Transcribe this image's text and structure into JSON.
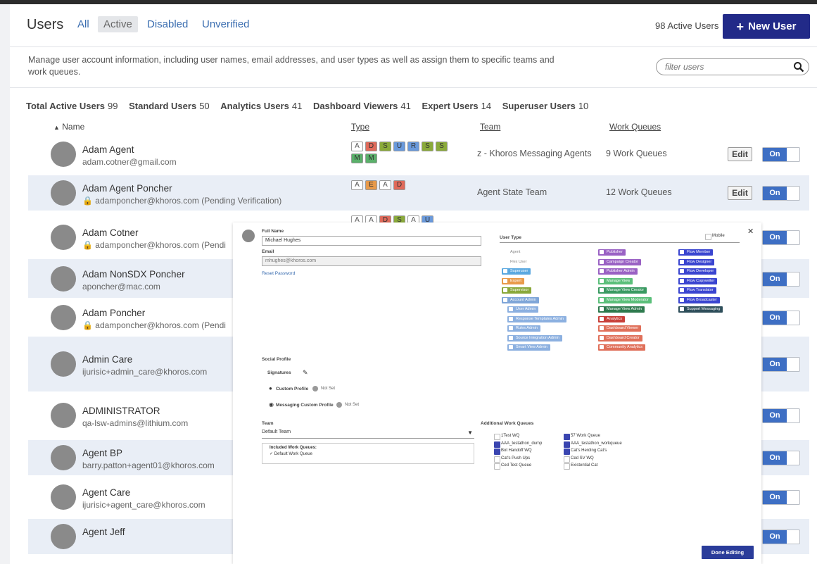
{
  "header": {
    "title": "Users",
    "tabs": [
      "All",
      "Active",
      "Disabled",
      "Unverified"
    ],
    "active_count": "98 Active Users",
    "new_user_label": "New User"
  },
  "description": "Manage user account information, including user names, email addresses, and user types as well as assign them to specific teams and work queues.",
  "filter": {
    "placeholder": "filter users"
  },
  "stats": [
    {
      "label": "Total Active Users",
      "value": "99"
    },
    {
      "label": "Standard Users",
      "value": "50"
    },
    {
      "label": "Analytics Users",
      "value": "41"
    },
    {
      "label": "Dashboard Viewers",
      "value": "41"
    },
    {
      "label": "Expert Users",
      "value": "14"
    },
    {
      "label": "Superuser Users",
      "value": "10"
    }
  ],
  "columns": {
    "name": "Name",
    "type": "Type",
    "team": "Team",
    "work_queues": "Work Queues"
  },
  "actions": {
    "edit": "Edit",
    "on": "On"
  },
  "colors": {
    "accent": "#222a88",
    "toggle": "#3e6fc4"
  },
  "users": [
    {
      "name": "Adam Agent",
      "email": "adam.cotner@gmail.com",
      "pending": "",
      "team": "z - Khoros Messaging Agents",
      "wq": "9 Work Queues",
      "badges": [
        "A",
        "D",
        "S",
        "U",
        "R",
        "S",
        "S",
        "M",
        "M"
      ]
    },
    {
      "name": "Adam Agent Poncher",
      "email": "adamponcher@khoros.com",
      "pending": "(Pending Verification)",
      "team": "Agent State Team",
      "wq": "12 Work Queues",
      "badges": [
        "A",
        "E",
        "A",
        "D"
      ]
    },
    {
      "name": "Adam Cotner",
      "email": "adamponcher@khoros.com",
      "pending": "(Pendi",
      "team": "",
      "wq": "",
      "badges": [
        "A",
        "A",
        "D",
        "S",
        "A",
        "U"
      ]
    },
    {
      "name": "Adam NonSDX Poncher",
      "email": "aponcher@mac.com",
      "pending": "",
      "team": "",
      "wq": "",
      "badges": []
    },
    {
      "name": "Adam Poncher",
      "email": "adamponcher@khoros.com",
      "pending": "(Pendi",
      "team": "",
      "wq": "",
      "badges": []
    },
    {
      "name": "Admin Care",
      "email": "ijurisic+admin_care@khoros.com",
      "pending": "",
      "team": "",
      "wq": "",
      "badges": []
    },
    {
      "name": "ADMINISTRATOR",
      "email": "qa-lsw-admins@lithium.com",
      "pending": "",
      "team": "",
      "wq": "",
      "badges": []
    },
    {
      "name": "Agent BP",
      "email": "barry.patton+agent01@khoros.com",
      "pending": "",
      "team": "",
      "wq": "",
      "badges": []
    },
    {
      "name": "Agent Care",
      "email": "ijurisic+agent_care@khoros.com",
      "pending": "",
      "team": "",
      "wq": "",
      "badges": []
    },
    {
      "name": "Agent Jeff",
      "email": "",
      "pending": "",
      "team": "",
      "wq": "",
      "badges": []
    }
  ],
  "modal": {
    "full_name_label": "Full Name",
    "full_name": "Michael Hughes",
    "email_label": "Email",
    "email": "mhughes@khoros.com",
    "reset_password": "Reset Password",
    "user_type_label": "User Type",
    "mobile": "Mobile",
    "col1": [
      {
        "t": "Agent",
        "c": "#ffffff"
      },
      {
        "t": "Flex User",
        "c": "#ffffff"
      },
      {
        "t": "Superuser",
        "c": "#5aa8e0"
      },
      {
        "t": "Expert",
        "c": "#e89a4a"
      },
      {
        "t": "Supervisor",
        "c": "#8aa83a"
      },
      {
        "t": "Account Admin",
        "c": "#7fa6d8"
      },
      {
        "t": "User Admin",
        "c": "#8cb0e0"
      },
      {
        "t": "Response Templates Admin",
        "c": "#8cb0e0"
      },
      {
        "t": "Rules Admin",
        "c": "#8cb0e0"
      },
      {
        "t": "Source Integration Admin",
        "c": "#8cb0e0"
      },
      {
        "t": "Smart View Admin",
        "c": "#8cb0e0"
      }
    ],
    "col2": [
      {
        "t": "Publisher",
        "c": "#9a62c4"
      },
      {
        "t": "Campaign Creator",
        "c": "#9a62c4"
      },
      {
        "t": "Publisher Admin",
        "c": "#9a62c4"
      },
      {
        "t": "Manage View",
        "c": "#5bbf7a"
      },
      {
        "t": "Manage View Creator",
        "c": "#3a9a62"
      },
      {
        "t": "Manage View Moderator",
        "c": "#5bbf7a"
      },
      {
        "t": "Manage View Admin",
        "c": "#2e7a4e"
      },
      {
        "t": "Analytics",
        "c": "#c8403a"
      },
      {
        "t": "Dashboard Viewer",
        "c": "#e0705a"
      },
      {
        "t": "Dashboard Creator",
        "c": "#e0705a"
      },
      {
        "t": "Community Analytics",
        "c": "#e0705a"
      }
    ],
    "col3": [
      {
        "t": "Flow Member",
        "c": "#3a45d0"
      },
      {
        "t": "Flow Designer",
        "c": "#3a45d0"
      },
      {
        "t": "Flow Developer",
        "c": "#3a45d0"
      },
      {
        "t": "Flow Copywriter",
        "c": "#3a45d0"
      },
      {
        "t": "Flow Translator",
        "c": "#3a45d0"
      },
      {
        "t": "Flow Broadcaster",
        "c": "#3a45d0"
      },
      {
        "t": "Support Messaging",
        "c": "#2e4e5a"
      }
    ],
    "social_profile": "Social Profile",
    "signatures": "Signatures",
    "custom_profile": "Custom Profile",
    "messaging_custom_profile": "Messaging Custom Profile",
    "not_set": "Not Set",
    "team_label": "Team",
    "team": "Default Team",
    "included_label": "Included Work Queues:",
    "included": "Default Work Queue",
    "awq_label": "Additional Work Queues",
    "awq_left": [
      {
        "t": "1Test WQ",
        "c": false
      },
      {
        "t": "AAA_testathon_dump",
        "c": true
      },
      {
        "t": "Bot Handoff WQ",
        "c": true
      },
      {
        "t": "Cat's Push Ups",
        "c": false
      },
      {
        "t": "Ced Test Queue",
        "c": false
      }
    ],
    "awq_right": [
      {
        "t": "57 Work Queue",
        "c": true
      },
      {
        "t": "AAA_testathon_workqueue",
        "c": true
      },
      {
        "t": "Cat's Herding Cat's",
        "c": true
      },
      {
        "t": "Ced SV WQ",
        "c": false
      },
      {
        "t": "Existential Cat",
        "c": false
      }
    ],
    "done": "Done Editing"
  }
}
